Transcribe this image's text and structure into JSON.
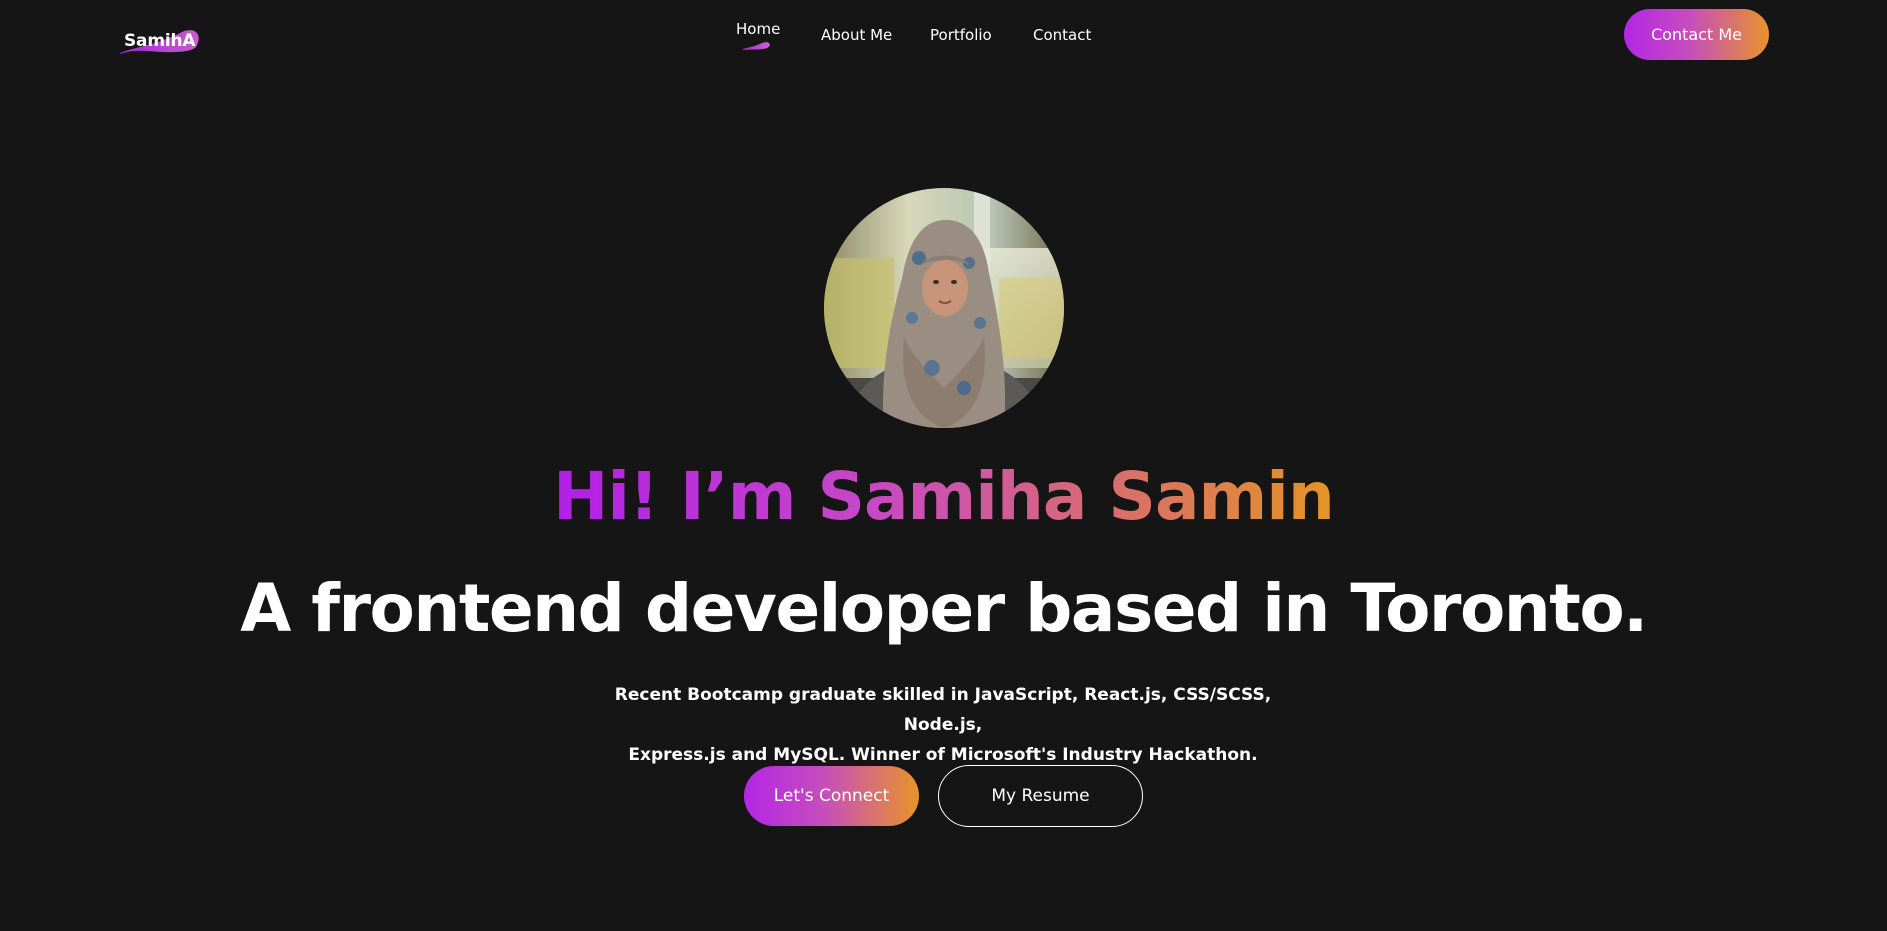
{
  "brand": {
    "logo_text": "SamihA"
  },
  "nav": {
    "items": [
      {
        "label": "Home",
        "active": true
      },
      {
        "label": "About Me",
        "active": false
      },
      {
        "label": "Portfolio",
        "active": false
      },
      {
        "label": "Contact",
        "active": false
      }
    ],
    "cta_label": "Contact Me"
  },
  "hero": {
    "avatar_icon": "profile-photo",
    "greeting": "Hi! I’m Samiha Samin",
    "title": "A frontend developer based in Toronto.",
    "description_line1": "Recent Bootcamp graduate skilled in JavaScript, React.js, CSS/SCSS, Node.js,",
    "description_line2": "Express.js and MySQL. Winner of Microsoft's Industry Hackathon.",
    "primary_button": "Let's Connect",
    "secondary_button": "My Resume"
  },
  "colors": {
    "background": "#161515",
    "gradient_start": "#b327e6",
    "gradient_mid": "#c64dbd",
    "gradient_end": "#e8932a",
    "text": "#ffffff"
  }
}
